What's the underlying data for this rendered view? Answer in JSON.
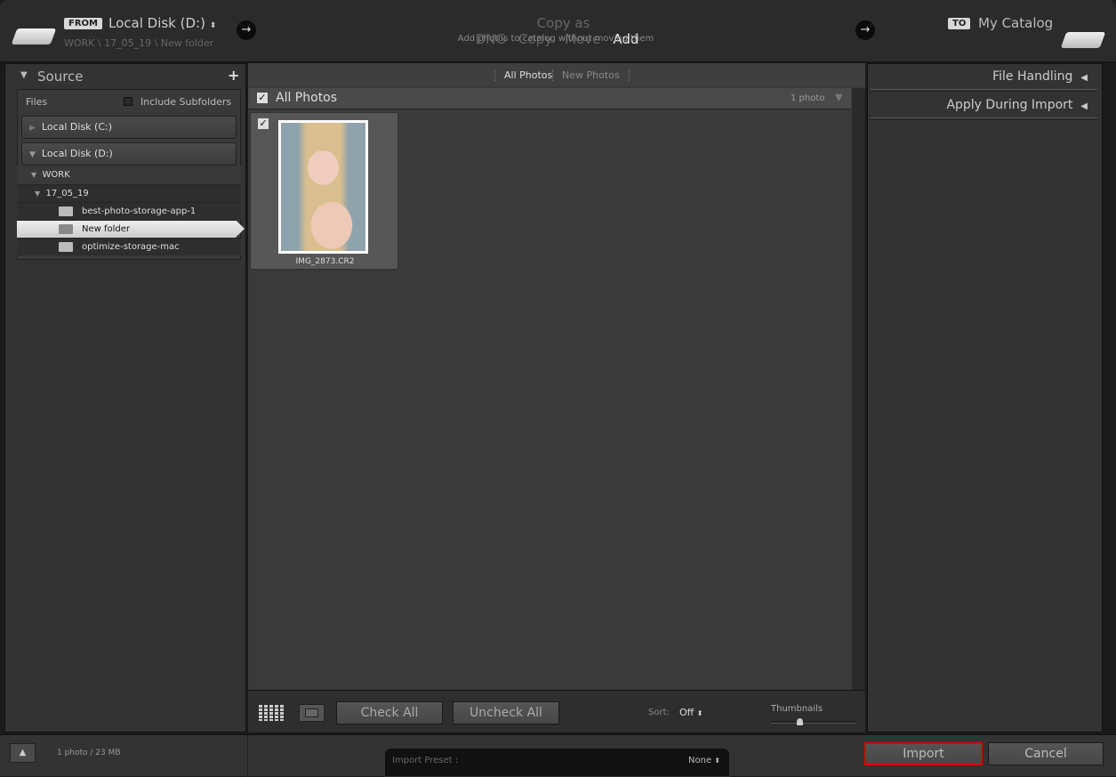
{
  "header": {
    "from_badge": "FROM",
    "source_name": "Local Disk (D:)",
    "source_path": "WORK \\ 17_05_19 \\ New folder",
    "modes": [
      "Copy as DNG",
      "Copy",
      "Move",
      "Add"
    ],
    "active_mode": "Add",
    "mode_description": "Add photos to catalog without moving them",
    "to_badge": "TO",
    "destination": "My Catalog"
  },
  "source": {
    "title": "Source",
    "files_label": "Files",
    "include_subfolders": "Include Subfolders",
    "include_subfolders_checked": false,
    "disks": [
      "Local Disk (C:)",
      "Local Disk (D:)"
    ],
    "tree": {
      "work": "WORK",
      "date": "17_05_19",
      "folders": [
        "best-photo-storage-app-1",
        "New folder",
        "optimize-storage-mac"
      ],
      "selected": "New folder"
    }
  },
  "center": {
    "tabs": [
      "All Photos",
      "New Photos"
    ],
    "active_tab": "All Photos",
    "grid_title": "All Photos",
    "count": "1 photo",
    "photos": [
      {
        "filename": "IMG_2873.CR2",
        "checked": true
      }
    ],
    "check_all": "Check All",
    "uncheck_all": "Uncheck All",
    "sort_label": "Sort:",
    "sort_value": "Off",
    "thumbnails_label": "Thumbnails",
    "thumbnail_size": 0.25
  },
  "right": {
    "sections": [
      "File Handling",
      "Apply During Import"
    ]
  },
  "footer": {
    "summary": "1 photo / 23 MB",
    "preset_label": "Import Preset :",
    "preset_value": "None",
    "import": "Import",
    "cancel": "Cancel"
  },
  "colors": {
    "highlight": "#e00000"
  }
}
